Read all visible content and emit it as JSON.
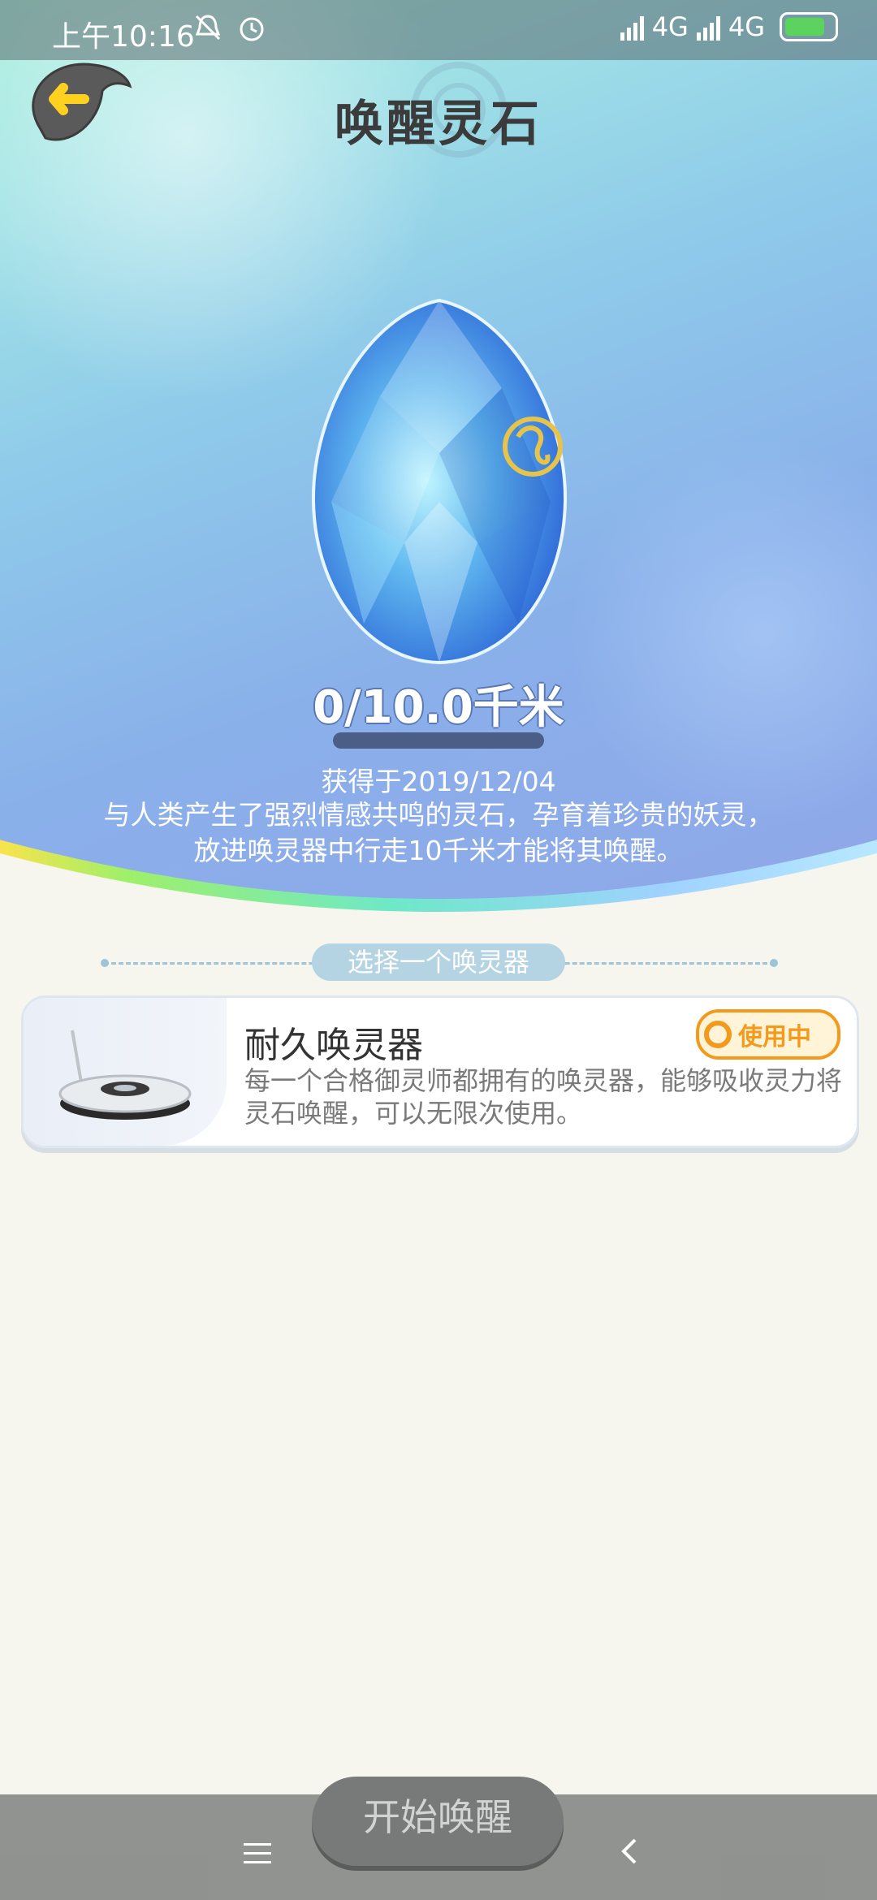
{
  "status_bar": {
    "time": "上午10:16",
    "network1": "4G",
    "network2": "4G"
  },
  "header": {
    "title": "唤醒灵石"
  },
  "stone": {
    "progress_text": "0/10.0千米",
    "progress_fraction": 0,
    "acquired": "获得于2019/12/04",
    "description_line1": "与人类产生了强烈情感共鸣的灵石，孕育着珍贵的妖灵，",
    "description_line2": "放进唤灵器中行走10千米才能将其唤醒。"
  },
  "selector": {
    "label": "选择一个唤灵器"
  },
  "device_card": {
    "title": "耐久唤灵器",
    "description": "每一个合格御灵师都拥有的唤灵器，能够吸收灵力将灵石唤醒，可以无限次使用。",
    "badge": "使用中",
    "icon": "incubator-icon"
  },
  "footer": {
    "start_button": "开始唤醒"
  },
  "colors": {
    "badge_orange": "#f39a1c",
    "accent_blue": "#8ab0ea"
  }
}
